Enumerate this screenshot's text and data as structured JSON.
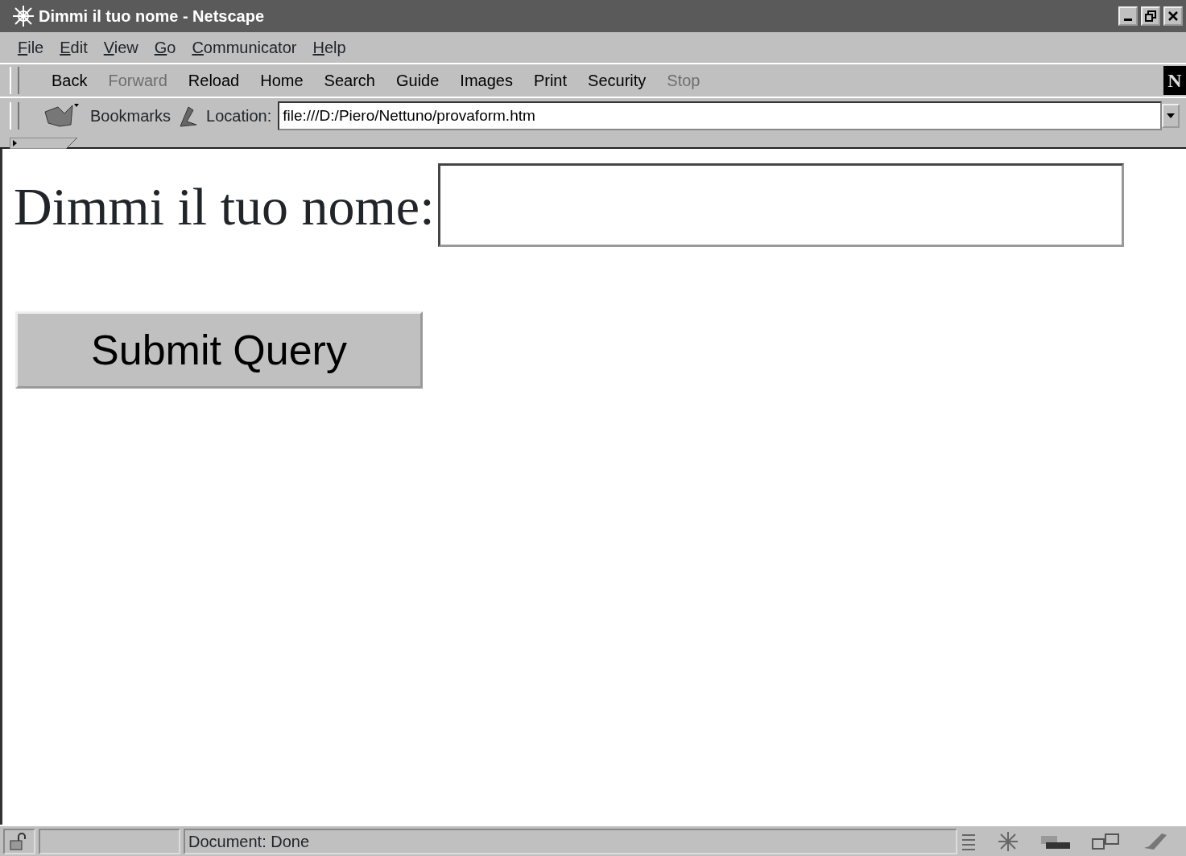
{
  "window": {
    "title": "Dimmi il tuo nome - Netscape"
  },
  "menu": [
    "File",
    "Edit",
    "View",
    "Go",
    "Communicator",
    "Help"
  ],
  "toolbar": [
    {
      "label": "Back",
      "disabled": false
    },
    {
      "label": "Forward",
      "disabled": true
    },
    {
      "label": "Reload",
      "disabled": false
    },
    {
      "label": "Home",
      "disabled": false
    },
    {
      "label": "Search",
      "disabled": false
    },
    {
      "label": "Guide",
      "disabled": false
    },
    {
      "label": "Images",
      "disabled": false
    },
    {
      "label": "Print",
      "disabled": false
    },
    {
      "label": "Security",
      "disabled": false
    },
    {
      "label": "Stop",
      "disabled": true
    }
  ],
  "logo_letter": "N",
  "location_bar": {
    "bookmarks": "Bookmarks",
    "location_label": "Location:",
    "url": "file:///D:/Piero/Nettuno/provaform.htm"
  },
  "form": {
    "label": "Dimmi il tuo nome:",
    "submit": "Submit Query"
  },
  "status_bar": {
    "text": "Document: Done"
  }
}
